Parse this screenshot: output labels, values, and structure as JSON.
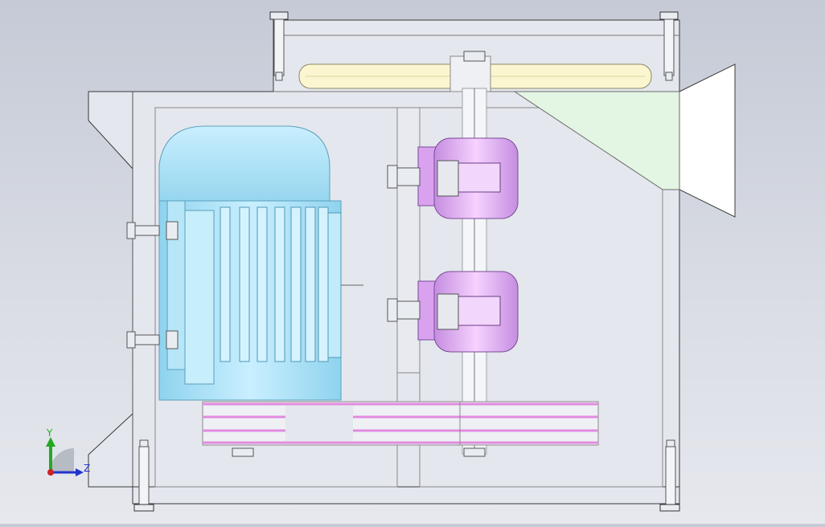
{
  "viewport": {
    "background_top": "#c5cad6",
    "background_bottom": "#e6e8ee"
  },
  "colors": {
    "frame_fill": "#e2e5ec",
    "frame_stroke": "#3a3a3a",
    "motor_fill": "#a8dff2",
    "motor_dark": "#7fc6e2",
    "bearing_fill": "#e0a6f0",
    "bearing_dark": "#b97ad6",
    "belt_pink": "#e89ae6",
    "pulley_fill": "#fbf6cf",
    "bracket_green": "#e2f4e2",
    "bolt_fill": "#e9edf2",
    "shaft_fill": "#f4f6fa"
  },
  "triad": {
    "y_label": "Y",
    "z_label": "Z",
    "y_color": "#22aa22",
    "z_color": "#2233cc",
    "x_color": "#cc2222"
  }
}
